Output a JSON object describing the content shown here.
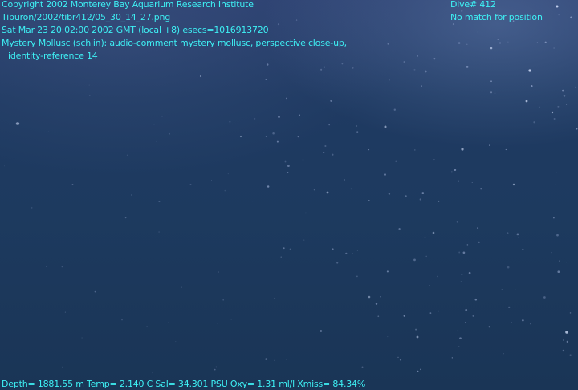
{
  "overlay": {
    "copyright": "Copyright 2002 Monterey Bay Aquarium Research Institute",
    "file_path": "Tiburon/2002/tibr412/05_30_14_27.png",
    "datetime": "Sat Mar 23 20:02:00 2002 GMT (local +8)  esecs=1016913720",
    "annotation_line1": "Mystery Mollusc (schlin): audio-comment mystery mollusc, perspective close-up,",
    "annotation_line2": "identity-reference 14",
    "dive": "Dive# 412",
    "position": "No match for position",
    "telemetry": "Depth= 1881.55 m  Temp= 2.140 C  Sal= 34.301 PSU  Oxy= 1.31 ml/l  Xmiss= 84.34%"
  },
  "colors": {
    "overlay_text": "#3ef0f4",
    "water_top": "#2a3f6e",
    "water_bottom": "#1a3556"
  }
}
